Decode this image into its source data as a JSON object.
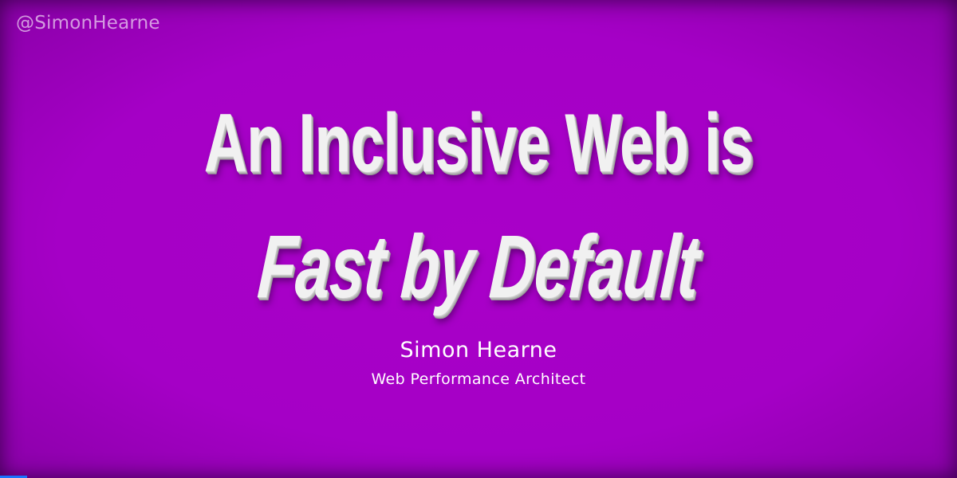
{
  "slide": {
    "handle": "@SimonHearne",
    "title_line_1": "An Inclusive Web is",
    "title_line_2": "Fast by Default",
    "speaker_name": "Simon Hearne",
    "speaker_role": "Web Performance Architect"
  },
  "progress": {
    "fraction": 0.028,
    "color": "#1a73ff"
  },
  "colors": {
    "background": "#a900c8",
    "title_text": "#f1f1f1",
    "body_text": "#ffffff"
  }
}
